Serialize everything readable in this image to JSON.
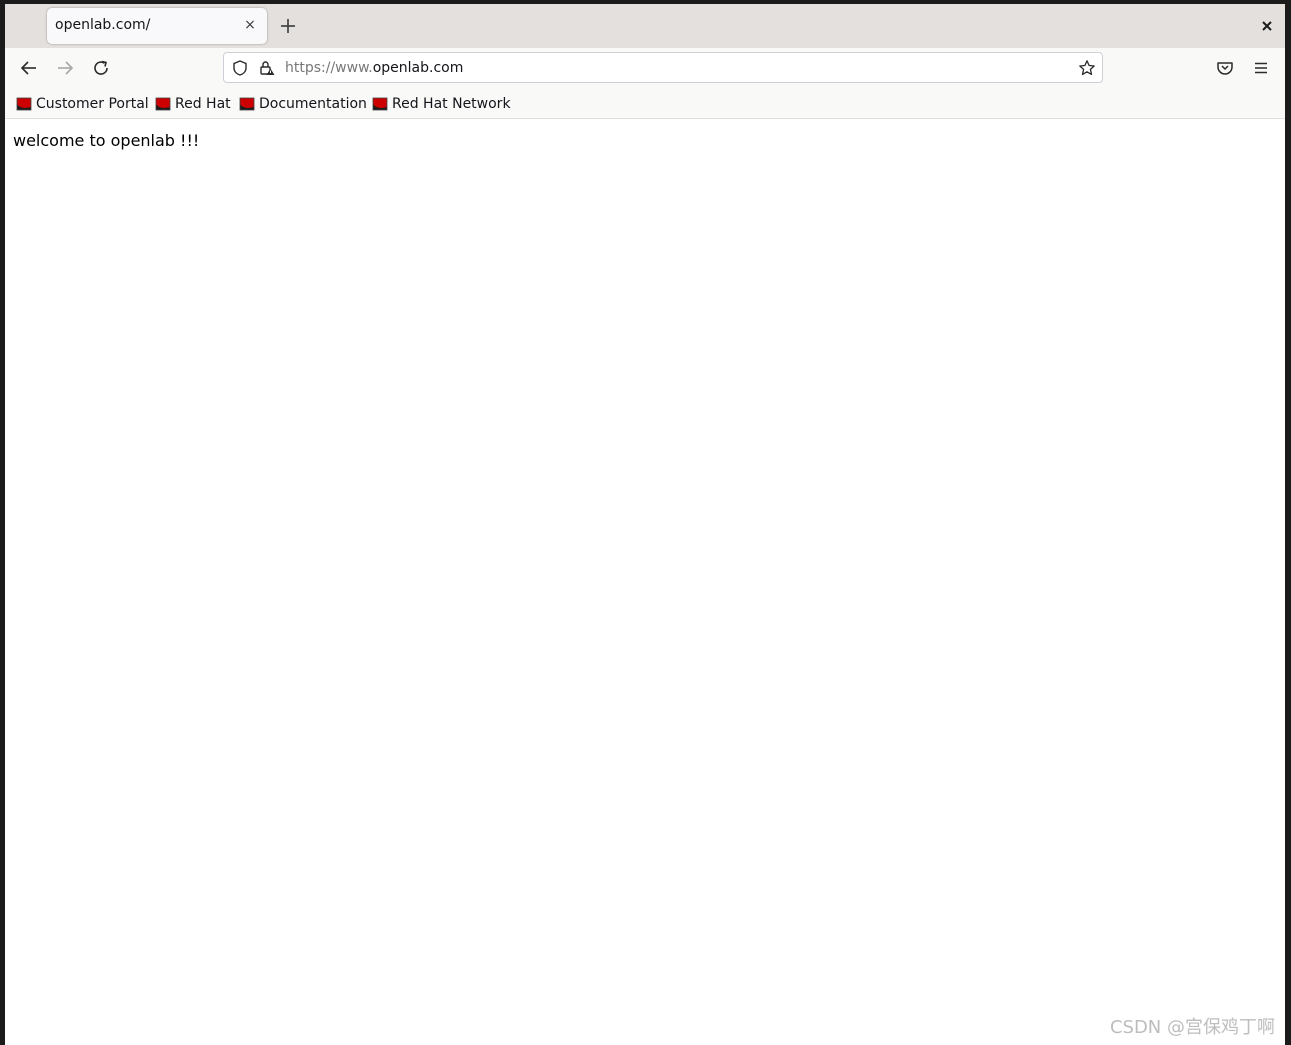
{
  "tab": {
    "title": "openlab.com/",
    "close_glyph": "×"
  },
  "toolbar": {
    "back_icon": "arrow-left-icon",
    "forward_icon": "arrow-right-icon",
    "reload_icon": "reload-icon"
  },
  "urlbar": {
    "scheme_prefix": "https://www.",
    "host": "openlab.com"
  },
  "bookmarks": [
    {
      "label": "Customer Portal"
    },
    {
      "label": "Red Hat"
    },
    {
      "label": "Documentation"
    },
    {
      "label": "Red Hat Network"
    }
  ],
  "page": {
    "text": "welcome to openlab !!!"
  },
  "watermark": {
    "text": "CSDN @宫保鸡丁啊"
  },
  "colors": {
    "bookmark_icon_red": "#cc0000",
    "tabstrip_bg": "#e3e0dd"
  }
}
